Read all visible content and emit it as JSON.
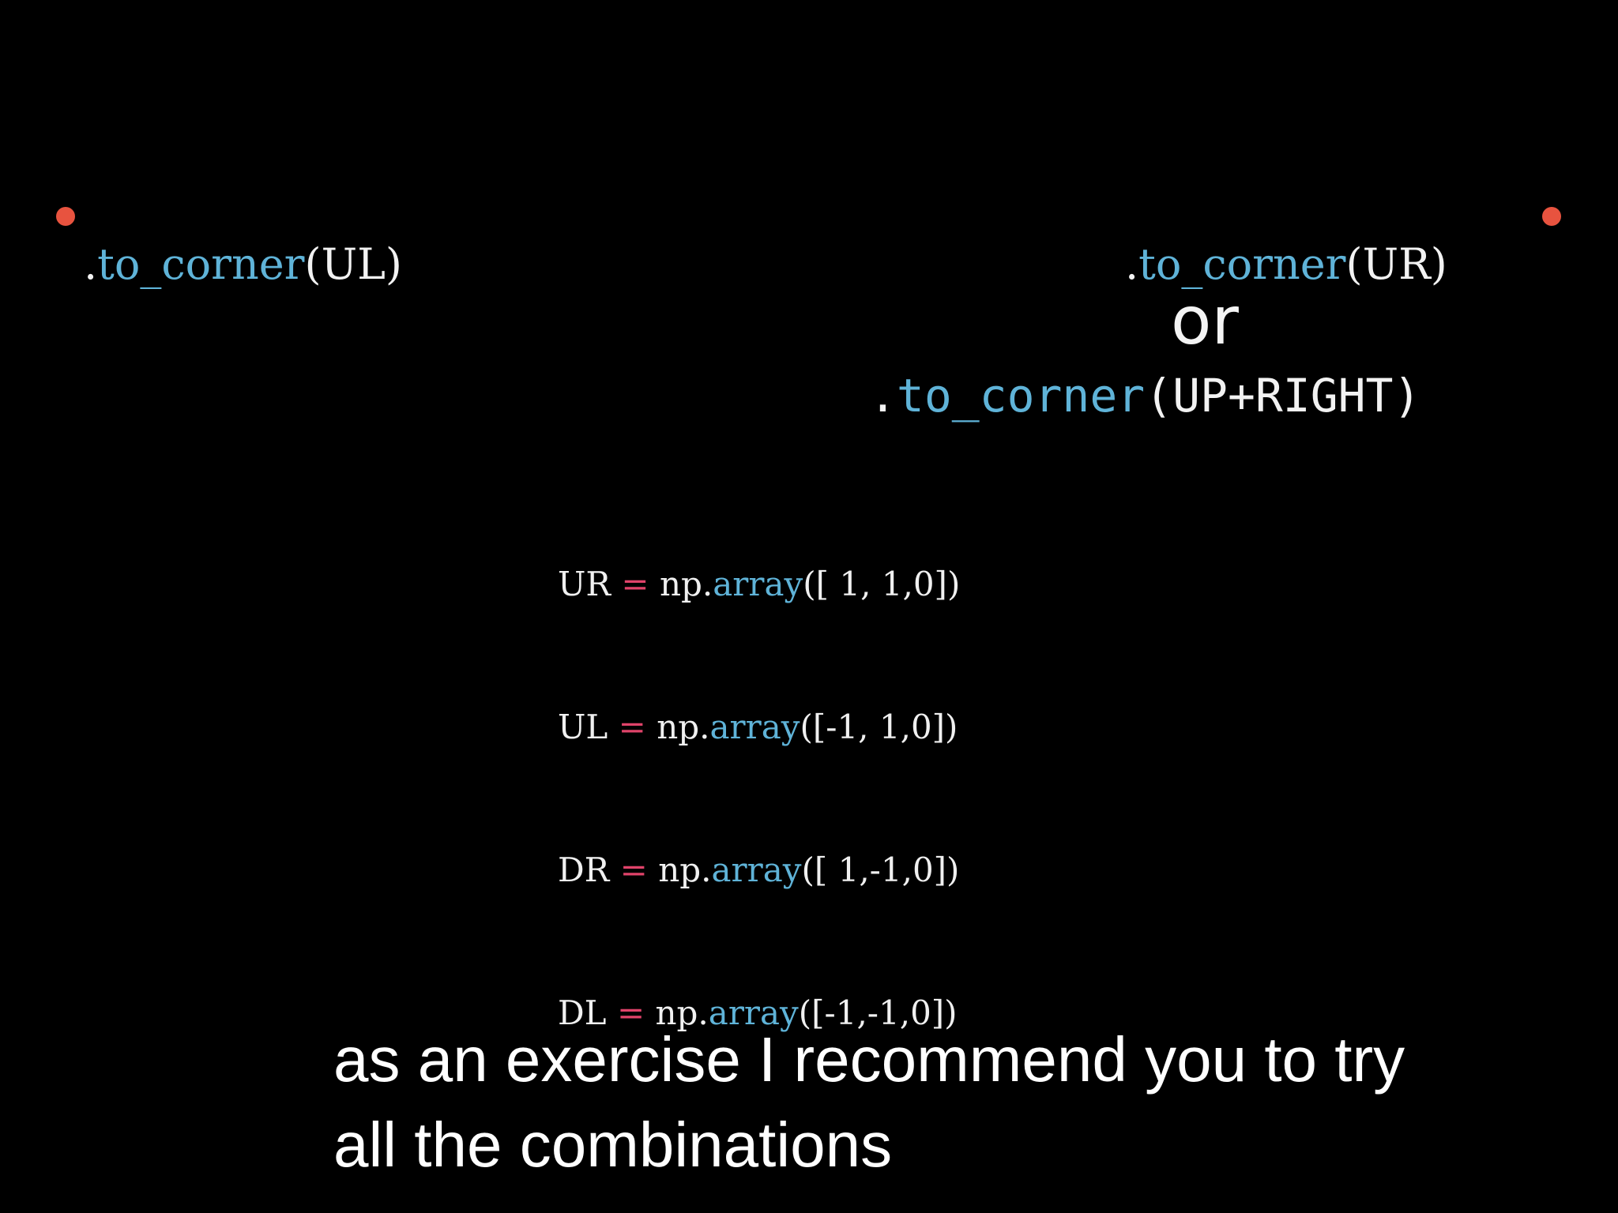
{
  "colors": {
    "background": "#000000",
    "dot": "#e8533f",
    "function_name": "#5fb3d8",
    "operator": "#e0436a",
    "text": "#f2f2f2"
  },
  "left_call": {
    "prefix": ".",
    "fn": "to_corner",
    "args": "(UL)"
  },
  "right_call": {
    "prefix": ".",
    "fn": "to_corner",
    "args": "(UR)"
  },
  "or_word": "or",
  "alt_call": {
    "prefix": ".",
    "fn": "to_corner",
    "args": "(UP+RIGHT)"
  },
  "code_lines": [
    {
      "name": "UR",
      "eq": "=",
      "pre": "np.",
      "fn": "array",
      "args": "([ 1, 1,0])"
    },
    {
      "name": "UL",
      "eq": "=",
      "pre": "np.",
      "fn": "array",
      "args": "([-1, 1,0])"
    },
    {
      "name": "DR",
      "eq": "=",
      "pre": "np.",
      "fn": "array",
      "args": "([ 1,-1,0])"
    },
    {
      "name": "DL",
      "eq": "=",
      "pre": "np.",
      "fn": "array",
      "args": "([-1,-1,0])"
    }
  ],
  "subtitle": {
    "line1": "as an exercise I recommend you to try",
    "line2": "all the combinations"
  }
}
